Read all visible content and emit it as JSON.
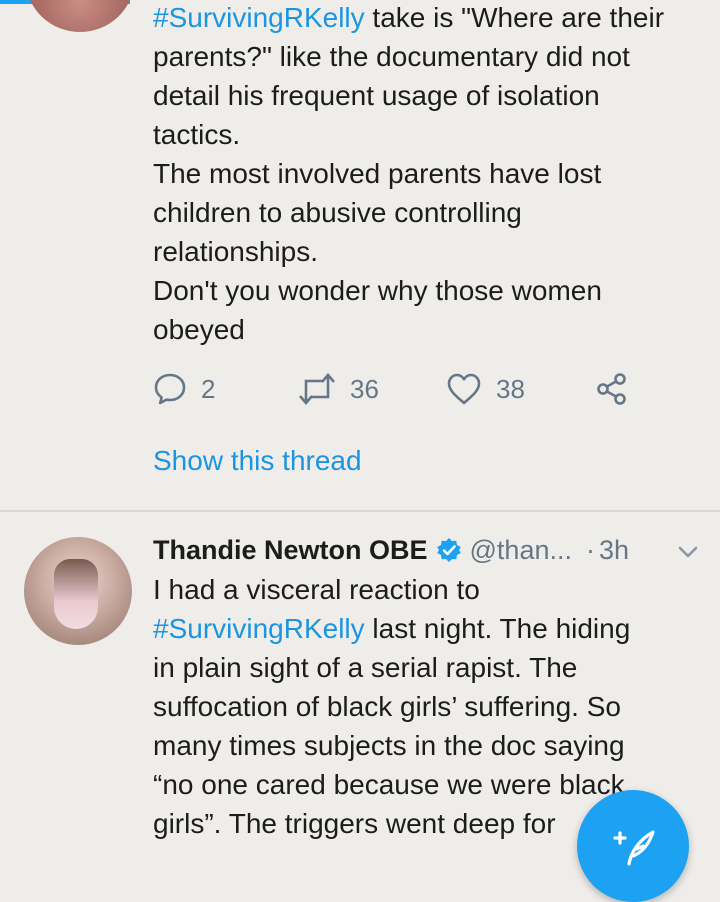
{
  "tweet1": {
    "lines": [
      {
        "hashtag": "#SurvivingRKelly",
        "text": " take is \"Where are their"
      },
      {
        "text": "parents?\" like the documentary did not"
      },
      {
        "text": "detail his frequent usage of isolation"
      },
      {
        "text": "tactics."
      },
      {
        "text": "The most involved parents have lost"
      },
      {
        "text": "children to abusive controlling"
      },
      {
        "text": "relationships."
      },
      {
        "text": "Don't you wonder why those women"
      },
      {
        "text": "obeyed"
      }
    ],
    "actions": {
      "replies": "2",
      "retweets": "36",
      "likes": "38"
    },
    "show_thread": "Show this thread"
  },
  "tweet2": {
    "name": "Thandie Newton OBE",
    "handle": "@than...",
    "dot": "·",
    "time": "3h",
    "lines": [
      {
        "text": "I had a visceral reaction to"
      },
      {
        "hashtag": "#SurvivingRKelly",
        "text": " last night. The hiding"
      },
      {
        "text": "in plain sight of a serial rapist. The"
      },
      {
        "text": "suffocation of black girls’ suffering. So"
      },
      {
        "text": "many times subjects in the doc saying"
      },
      {
        "text": "“no one cared because we were black"
      },
      {
        "text": "girls”. The triggers went deep for"
      }
    ]
  },
  "icons": {
    "reply": "reply-icon",
    "retweet": "retweet-icon",
    "like": "heart-icon",
    "share": "share-icon",
    "verified": "verified-badge-icon",
    "menu": "chevron-down-icon",
    "compose": "compose-tweet-icon"
  },
  "colors": {
    "accent": "#1da1f2",
    "link": "#1b95e0",
    "muted": "#657786",
    "background": "#efedea"
  }
}
